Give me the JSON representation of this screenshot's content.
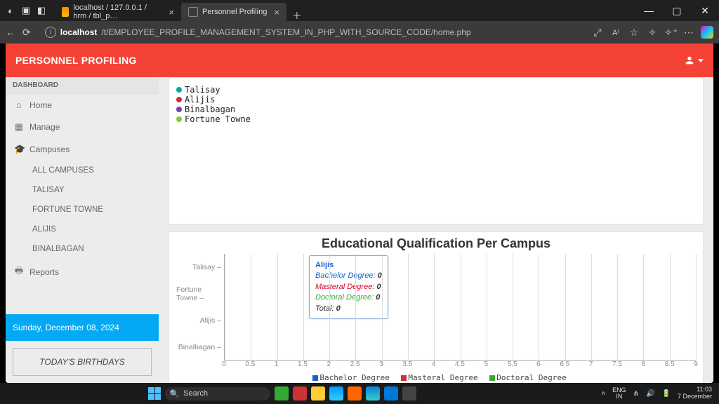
{
  "browser": {
    "tab1_title": "localhost / 127.0.0.1 / hrm / tbl_p…",
    "tab2_title": "Personnel Profiling",
    "url_host": "localhost",
    "url_path": "/t/EMPLOYEE_PROFILE_MANAGEMENT_SYSTEM_IN_PHP_WITH_SOURCE_CODE/home.php"
  },
  "header": {
    "brand": "PERSONNEL PROFILING"
  },
  "sidebar": {
    "section": "DASHBOARD",
    "items": {
      "home": "Home",
      "manage": "Manage",
      "campuses": "Campuses",
      "reports": "Reports"
    },
    "campuses": {
      "all": "ALL CAMPUSES",
      "talisay": "TALISAY",
      "fortune": "FORTUNE TOWNE",
      "alijis": "ALIJIS",
      "binalbagan": "BINALBAGAN"
    },
    "date": "Sunday, December 08, 2024",
    "birthdays": "TODAY'S BIRTHDAYS"
  },
  "upper_legend": {
    "talisay": "Talisay",
    "alijis": "Alijis",
    "binalbagan": "Binalbagan",
    "fortune": "Fortune Towne"
  },
  "chart_data": {
    "type": "bar",
    "title": "Educational Qualification Per Campus",
    "categories": [
      "Talisay",
      "Fortune Towne",
      "Alijis",
      "Binalbagan"
    ],
    "series": [
      {
        "name": "Bachelor Degree",
        "values": [
          0,
          0,
          0,
          0
        ],
        "color": "#1a5fcc"
      },
      {
        "name": "Masteral Degree",
        "values": [
          0,
          0,
          0,
          0
        ],
        "color": "#d03030"
      },
      {
        "name": "Doctoral Degree",
        "values": [
          0,
          0,
          0,
          0
        ],
        "color": "#3aa33a"
      }
    ],
    "xlabel": "",
    "ylabel": "",
    "xlim": [
      0,
      9
    ],
    "x_ticks": [
      "0",
      "0.5",
      "1",
      "1.5",
      "2",
      "2.5",
      "3",
      "3.5",
      "4",
      "4.5",
      "5",
      "5.5",
      "6",
      "6.5",
      "7",
      "7.5",
      "8",
      "8.5",
      "9"
    ]
  },
  "tooltip": {
    "title": "Alijis",
    "bachelor_label": "Bachelor Degree:",
    "bachelor_value": "0",
    "masteral_label": "Masteral Degree:",
    "masteral_value": "0",
    "doctoral_label": "Doctoral Degree:",
    "doctoral_value": "0",
    "total_label": "Total:",
    "total_value": "0"
  },
  "chart_legend": {
    "bachelor": "Bachelor Degree",
    "masteral": "Masteral Degree",
    "doctoral": "Doctoral Degree"
  },
  "taskbar": {
    "search_placeholder": "Search",
    "lang1": "ENG",
    "lang2": "IN",
    "time": "11:03",
    "date": "7 December"
  },
  "colors": {
    "talisay": "#00a99d",
    "alijis": "#d03030",
    "binalbagan": "#7b3fb3",
    "fortune": "#8cc63f"
  }
}
